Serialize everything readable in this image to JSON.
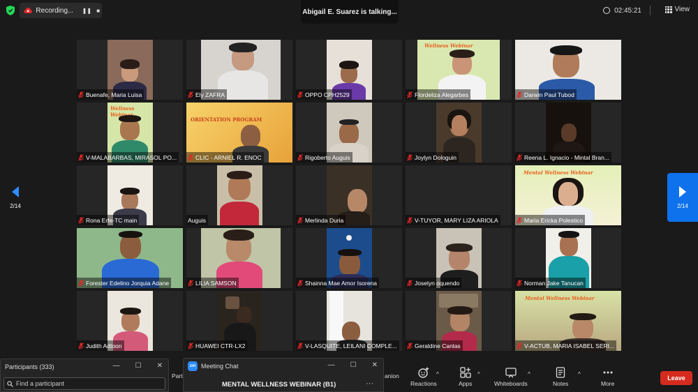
{
  "topbar": {
    "recording_label": "Recording...",
    "talking_text": "Abigail E. Suarez is talking...",
    "timer": "02:45:21",
    "view_label": "View"
  },
  "gallery": {
    "page_indicator_left": "2/14",
    "page_indicator_right": "2/14",
    "tiles": [
      {
        "name": "Buenafe, Maria Luisa"
      },
      {
        "name": "Ely ZAFRA"
      },
      {
        "name": "OPPO CPH2529"
      },
      {
        "name": "Flordeliza Alegarbes"
      },
      {
        "name": "Darwin Paul Tubod"
      },
      {
        "name": "V-MALABARBAS, MIRASOL PO..."
      },
      {
        "name": "CLIC - ARNIEL R. ENOC"
      },
      {
        "name": "Rigoberto Auguis"
      },
      {
        "name": "Joylyn Dologuin"
      },
      {
        "name": "Reena L. Ignacio - Mintal Bran..."
      },
      {
        "name": "Rona Erfe-TC main"
      },
      {
        "name": "Auguis"
      },
      {
        "name": "Merlinda Duria"
      },
      {
        "name": "V-TUYOR, MARY LIZA ARIOLA"
      },
      {
        "name": "Maria Ericka Polestico"
      },
      {
        "name": "Forester Edelino Jorquia Adane"
      },
      {
        "name": "LILIA SAMSON"
      },
      {
        "name": "Shainna Mae Amor Isorena"
      },
      {
        "name": "Joselyn oquendo"
      },
      {
        "name": "Norman Jake Tanucan"
      },
      {
        "name": "Judith Adtoon"
      },
      {
        "name": "HUAWEI CTR-LX2"
      },
      {
        "name": "V-LASQUITE, LEILANI COMPLE..."
      },
      {
        "name": "Geraldine Canlas"
      },
      {
        "name": "V-ACTUB, MARIA ISABEL SERI..."
      }
    ],
    "banner_texts": {
      "wellness_short": "Wellness Webinar",
      "orientation": "ORIENTATION PROGRAM",
      "mental_wellness": "Mental Wellness Webinar"
    }
  },
  "participants_window": {
    "title": "Participants (333)",
    "search_placeholder": "Find a participant"
  },
  "chat_window": {
    "title": "Meeting Chat",
    "logo": "zm",
    "channel": "MENTAL WELLNESS WEBINAR (B1)"
  },
  "toolbar": {
    "partial_left": "Parti",
    "partial_companion": "anion",
    "reactions": "Reactions",
    "apps": "Apps",
    "whiteboards": "Whiteboards",
    "notes": "Notes",
    "more": "More",
    "leave": "Leave"
  }
}
